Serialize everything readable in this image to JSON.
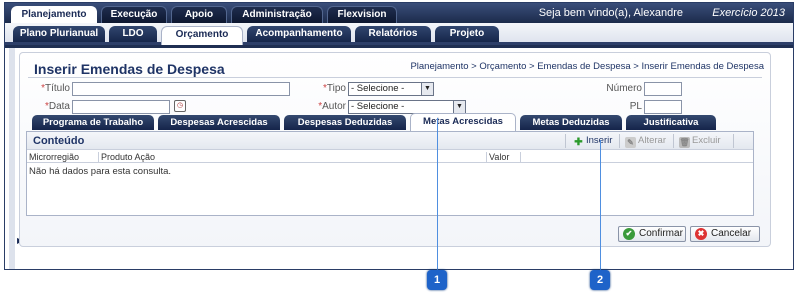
{
  "top_nav": {
    "tabs": [
      "Planejamento",
      "Execução",
      "Apoio",
      "Administração",
      "Flexvision"
    ],
    "active": "Planejamento",
    "welcome": "Seja bem vindo(a), Alexandre",
    "exercicio": "Exercício 2013"
  },
  "sub_nav": {
    "tabs": [
      "Plano Plurianual",
      "LDO",
      "Orçamento",
      "Acompanhamento",
      "Relatórios",
      "Projeto"
    ],
    "active": "Orçamento"
  },
  "page": {
    "title": "Inserir Emendas de Despesa",
    "breadcrumb": "Planejamento > Orçamento > Emendas de Despesa > Inserir Emendas de Despesa"
  },
  "form": {
    "titulo_label": "Título",
    "data_label": "Data",
    "tipo_label": "Tipo",
    "tipo_value": "- Selecione -",
    "autor_label": "Autor",
    "autor_value": "- Selecione -",
    "numero_label": "Número",
    "pl_label": "PL",
    "required_mark": "*"
  },
  "inner_tabs": {
    "tabs": [
      "Programa de Trabalho",
      "Despesas Acrescidas",
      "Despesas Deduzidas",
      "Metas Acrescidas",
      "Metas Deduzidas",
      "Justificativa"
    ],
    "active": "Metas Acrescidas"
  },
  "content_box": {
    "title": "Conteúdo",
    "toolbar": {
      "insert": "Inserir",
      "edit": "Alterar",
      "delete": "Excluir"
    },
    "columns": [
      "Microrregião",
      "Produto Ação",
      "Valor"
    ],
    "empty_message": "Não há dados para esta consulta."
  },
  "actions": {
    "confirm": "Confirmar",
    "cancel": "Cancelar"
  },
  "callouts": [
    "1",
    "2"
  ],
  "colors": {
    "nav_dark": "#1c2b4b",
    "accent": "#1f3466",
    "callout": "#1e63c9"
  }
}
